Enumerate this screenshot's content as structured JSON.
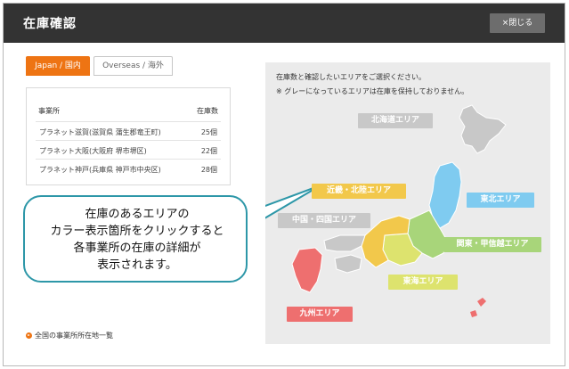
{
  "window": {
    "title": "在庫確認",
    "close_label": "×閉じる"
  },
  "tabs": [
    {
      "label": "Japan / 国内",
      "active": true
    },
    {
      "label": "Overseas / 海外",
      "active": false
    }
  ],
  "table": {
    "headers": {
      "office": "事業所",
      "stock": "在庫数"
    },
    "rows": [
      {
        "office": "プラネット滋賀(滋賀県 蒲生郡竜王町)",
        "stock": "25個"
      },
      {
        "office": "プラネット大阪(大阪府 堺市堺区)",
        "stock": "22個"
      },
      {
        "office": "プラネット神戸(兵庫県 神戸市中央区)",
        "stock": "28個"
      }
    ]
  },
  "map": {
    "instruction": "在庫数と確認したいエリアをご選択ください。",
    "note": "※ グレーになっているエリアは在庫を保持しておりません。",
    "areas": [
      {
        "label": "北海道エリア",
        "color": "#c8c8c8"
      },
      {
        "label": "東北エリア",
        "color": "#7fcbf0"
      },
      {
        "label": "近畿・北陸エリア",
        "color": "#f2c84b"
      },
      {
        "label": "中国・四国エリア",
        "color": "#c8c8c8"
      },
      {
        "label": "関東・甲信越エリア",
        "color": "#a8d57a"
      },
      {
        "label": "東海エリア",
        "color": "#dde36e"
      },
      {
        "label": "九州エリア",
        "color": "#ee6f6f"
      }
    ]
  },
  "callout": {
    "lines": [
      "在庫のあるエリアの",
      "カラー表示箇所をクリックすると",
      "各事業所の在庫の詳細が",
      "表示されます。"
    ]
  },
  "footer": {
    "link_label": "全国の事業所所在地一覧"
  },
  "colors": {
    "accent": "#ee7413",
    "header": "#333333",
    "callout_border": "#2d97a8"
  }
}
